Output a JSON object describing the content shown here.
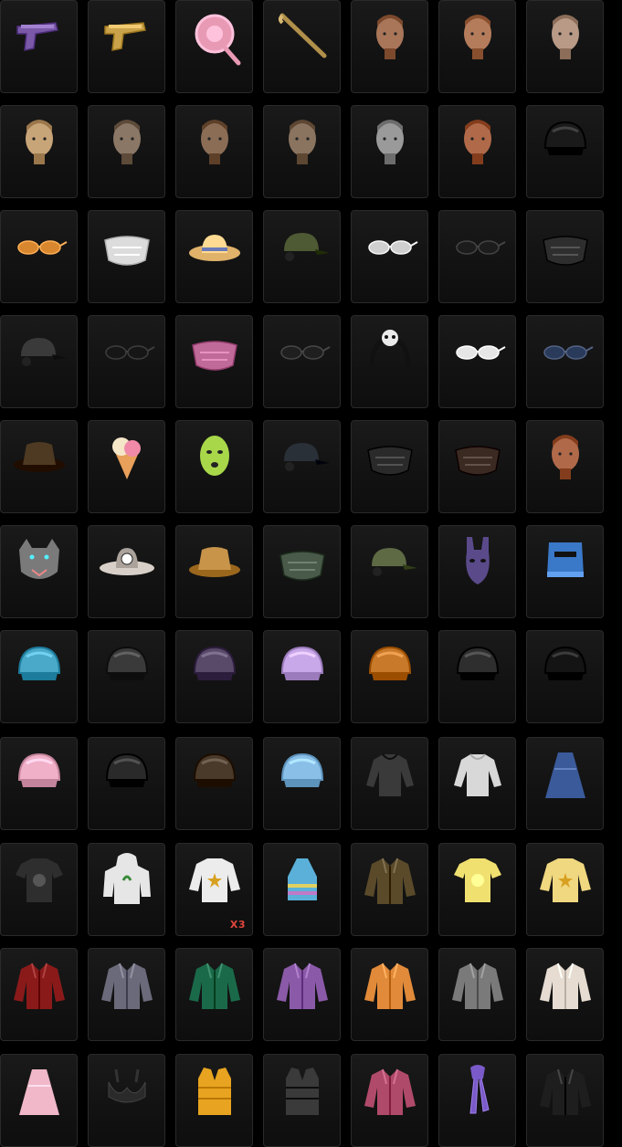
{
  "inventory": {
    "columns": 7,
    "items": [
      {
        "icon": "pistol-purple-icon",
        "kind": "pistol",
        "color": "#7a5aa8"
      },
      {
        "icon": "pistol-gold-icon",
        "kind": "pistol",
        "color": "#c9a24a"
      },
      {
        "icon": "pink-lollipop-pan-icon",
        "kind": "pan",
        "color": "#e89ab4"
      },
      {
        "icon": "gold-crowbar-icon",
        "kind": "stick",
        "color": "#b0904a"
      },
      {
        "icon": "female-face-icon",
        "kind": "face",
        "color": "#a9765a"
      },
      {
        "icon": "bald-male-face-icon",
        "kind": "face",
        "color": "#b57c5c"
      },
      {
        "icon": "female-ponytail-face-icon",
        "kind": "face",
        "color": "#b89a86"
      },
      {
        "icon": "blonde-braid-hair-icon",
        "kind": "face",
        "color": "#c8a479"
      },
      {
        "icon": "short-hair-male-icon",
        "kind": "face",
        "color": "#8a7766"
      },
      {
        "icon": "messy-hair-male-icon",
        "kind": "face",
        "color": "#8b6d56"
      },
      {
        "icon": "side-part-hair-icon",
        "kind": "face",
        "color": "#8a7460"
      },
      {
        "icon": "bald-mannequin-head-icon",
        "kind": "face",
        "color": "#9a9a9a"
      },
      {
        "icon": "red-hair-female-face-icon",
        "kind": "face",
        "color": "#b06a4a"
      },
      {
        "icon": "black-visor-helmet-icon",
        "kind": "helmet",
        "color": "#1a1a1a"
      },
      {
        "icon": "orange-visor-glasses-icon",
        "kind": "glasses",
        "color": "#d9872e"
      },
      {
        "icon": "zebra-face-mask-icon",
        "kind": "mask",
        "color": "#dcdcdc"
      },
      {
        "icon": "straw-sun-hat-icon",
        "kind": "hat",
        "color": "#e0b26a"
      },
      {
        "icon": "military-cap-headset-icon",
        "kind": "cap",
        "color": "#4e5a34"
      },
      {
        "icon": "shutter-shades-icon",
        "kind": "glasses",
        "color": "#cfcfcf"
      },
      {
        "icon": "black-sunglasses-icon",
        "kind": "glasses",
        "color": "#1c1c1c"
      },
      {
        "icon": "black-pattern-mask-icon",
        "kind": "mask",
        "color": "#2e2e2e"
      },
      {
        "icon": "black-baseball-cap-icon",
        "kind": "cap",
        "color": "#3a3a3a"
      },
      {
        "icon": "black-headband-icon",
        "kind": "glasses",
        "color": "#161616"
      },
      {
        "icon": "spiked-face-mask-icon",
        "kind": "mask",
        "color": "#c06a9a"
      },
      {
        "icon": "dark-goggles-icon",
        "kind": "glasses",
        "color": "#1f1f1f"
      },
      {
        "icon": "panda-headband-icon",
        "kind": "headband",
        "color": "#eaeaea"
      },
      {
        "icon": "white-sport-glasses-icon",
        "kind": "glasses",
        "color": "#e6e6e6"
      },
      {
        "icon": "blue-wrap-sunglasses-icon",
        "kind": "glasses",
        "color": "#2a3a5a"
      },
      {
        "icon": "brown-bucket-hat-icon",
        "kind": "bucket",
        "color": "#4e3a22"
      },
      {
        "icon": "ice-cream-cone-hat-icon",
        "kind": "icecream",
        "color": "#e8a05a"
      },
      {
        "icon": "green-balaclava-icon",
        "kind": "balaclava",
        "color": "#a8d84a"
      },
      {
        "icon": "dark-cap-goggles-icon",
        "kind": "cap",
        "color": "#2a3038"
      },
      {
        "icon": "black-graffiti-mask-icon",
        "kind": "mask",
        "color": "#2a2a2a"
      },
      {
        "icon": "leather-gas-mask-icon",
        "kind": "mask",
        "color": "#3a2a22"
      },
      {
        "icon": "face-paint-female-icon",
        "kind": "face",
        "color": "#b06a4a"
      },
      {
        "icon": "wolf-head-mask-icon",
        "kind": "wolf",
        "color": "#7a7a7a"
      },
      {
        "icon": "soccer-cowboy-hat-icon",
        "kind": "cowboy",
        "color": "#d8d0c8"
      },
      {
        "icon": "tan-bucket-hat-icon",
        "kind": "bucket",
        "color": "#c8944a"
      },
      {
        "icon": "camo-face-wrap-icon",
        "kind": "mask",
        "color": "#4a5a4a"
      },
      {
        "icon": "green-cap-headset-icon",
        "kind": "cap",
        "color": "#5e6a44"
      },
      {
        "icon": "purple-bunny-mask-icon",
        "kind": "bunny",
        "color": "#5a4a8a"
      },
      {
        "icon": "blue-bucket-helmet-icon",
        "kind": "bluehelmet",
        "color": "#3a78c8"
      },
      {
        "icon": "striped-visor-helmet-icon",
        "kind": "helmet",
        "color": "#4aa8c8"
      },
      {
        "icon": "black-red-helmet-icon",
        "kind": "helmet",
        "color": "#3a3a3a"
      },
      {
        "icon": "horned-demon-helmet-icon",
        "kind": "helmet",
        "color": "#5a4a6a"
      },
      {
        "icon": "lavender-helmet-icon",
        "kind": "helmet",
        "color": "#c8a8e8"
      },
      {
        "icon": "orange-camo-helmet-icon",
        "kind": "helmet",
        "color": "#c87a2a"
      },
      {
        "icon": "black-military-helmet-icon",
        "kind": "helmet",
        "color": "#2e2e2e"
      },
      {
        "icon": "black-motorcycle-helmet-icon",
        "kind": "helmet",
        "color": "#141414"
      },
      {
        "icon": "rainbow-helmet-icon",
        "kind": "helmet",
        "color": "#f0b0c8"
      },
      {
        "icon": "anubis-helmet-icon",
        "kind": "helmet",
        "color": "#2a2a2a"
      },
      {
        "icon": "steampunk-helmet-icon",
        "kind": "helmet",
        "color": "#4a3a2a"
      },
      {
        "icon": "sky-blue-helmet-icon",
        "kind": "helmet",
        "color": "#8ac0e8"
      },
      {
        "icon": "gothic-harness-top-icon",
        "kind": "top",
        "color": "#3a3a3a"
      },
      {
        "icon": "white-sleeve-top-icon",
        "kind": "top",
        "color": "#d8d8d8"
      },
      {
        "icon": "blue-gold-dress-icon",
        "kind": "dress",
        "color": "#3a5a9a"
      },
      {
        "icon": "graphic-crop-tee-icon",
        "kind": "tee",
        "color": "#2e2e2e"
      },
      {
        "icon": "white-leaf-hoodie-icon",
        "kind": "hoodie",
        "color": "#e6e6e6"
      },
      {
        "icon": "white-star-sweatshirt-icon",
        "kind": "sweater",
        "color": "#ececec",
        "count": "X3"
      },
      {
        "icon": "tie-dye-halter-top-icon",
        "kind": "halter",
        "color": "#5ab0d8"
      },
      {
        "icon": "brown-vest-jacket-icon",
        "kind": "jacket",
        "color": "#5a4a2a"
      },
      {
        "icon": "yellow-duck-tee-icon",
        "kind": "tee",
        "color": "#f0e070"
      },
      {
        "icon": "yellow-fuzzy-sweater-icon",
        "kind": "sweater",
        "color": "#f0d880"
      },
      {
        "icon": "red-leather-jacket-icon",
        "kind": "jacket",
        "color": "#8a1a1a"
      },
      {
        "icon": "grey-button-shirt-icon",
        "kind": "jacket",
        "color": "#6a6a7a"
      },
      {
        "icon": "green-varsity-jacket-icon",
        "kind": "jacket",
        "color": "#1a6a4a"
      },
      {
        "icon": "purple-iridescent-jacket-icon",
        "kind": "jacket",
        "color": "#8a5aa8"
      },
      {
        "icon": "orange-stripe-shirt-icon",
        "kind": "jacket",
        "color": "#e08a3a"
      },
      {
        "icon": "grey-red-jacket-icon",
        "kind": "jacket",
        "color": "#7a7a7a"
      },
      {
        "icon": "white-floral-jacket-icon",
        "kind": "jacket",
        "color": "#e6dcd2"
      },
      {
        "icon": "pink-hooded-dress-icon",
        "kind": "dress",
        "color": "#f0b8c8"
      },
      {
        "icon": "black-bra-top-icon",
        "kind": "bra",
        "color": "#2a2a2a"
      },
      {
        "icon": "yellow-puffer-vest-icon",
        "kind": "vest",
        "color": "#e8a420"
      },
      {
        "icon": "tactical-vest-icon",
        "kind": "vest",
        "color": "#3a3a3a"
      },
      {
        "icon": "pink-striped-jacket-icon",
        "kind": "jacket",
        "color": "#b04a6a"
      },
      {
        "icon": "purple-scarf-icon",
        "kind": "scarf",
        "color": "#7a5ac8"
      },
      {
        "icon": "black-gold-jacket-icon",
        "kind": "jacket",
        "color": "#1e1e1e"
      }
    ]
  }
}
